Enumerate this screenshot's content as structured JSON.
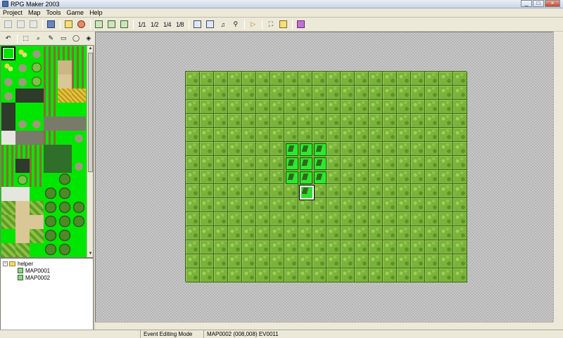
{
  "window": {
    "title": "RPG Maker 2003"
  },
  "menu": {
    "items": [
      "Project",
      "Map",
      "Tools",
      "Game",
      "Help"
    ]
  },
  "toolbar": {
    "layer_labels": [
      "1/1",
      "1/2",
      "1/4",
      "1/8"
    ]
  },
  "tileset": {
    "selected_index": 0
  },
  "map_tree": {
    "root": "helper",
    "maps": [
      "MAP0001",
      "MAP0002"
    ]
  },
  "map": {
    "columns": 20,
    "rows": 15,
    "events": [
      {
        "col": 7,
        "row": 5
      },
      {
        "col": 8,
        "row": 5
      },
      {
        "col": 9,
        "row": 5
      },
      {
        "col": 7,
        "row": 6
      },
      {
        "col": 8,
        "row": 6
      },
      {
        "col": 9,
        "row": 6
      },
      {
        "col": 7,
        "row": 7
      },
      {
        "col": 8,
        "row": 7
      },
      {
        "col": 9,
        "row": 7
      },
      {
        "col": 8,
        "row": 8,
        "cursor": true
      }
    ]
  },
  "status": {
    "mode": "Event Editing Mode",
    "location": "MAP0002 (008,008)  EV0011"
  }
}
